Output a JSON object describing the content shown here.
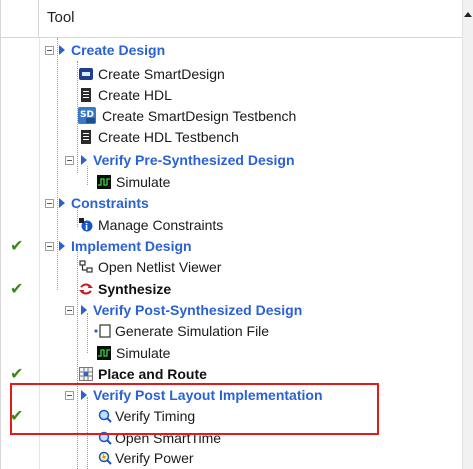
{
  "header": {
    "column_label": "Tool"
  },
  "colors": {
    "category": "#2a62d4",
    "check": "#3a8a1c",
    "highlight": "#e11a1a"
  },
  "rows": [
    {
      "label": "Create Design",
      "style": "category",
      "check": ""
    },
    {
      "label": "Create SmartDesign",
      "icon": "smartdesign-icon",
      "check": ""
    },
    {
      "label": "Create HDL",
      "icon": "hdl-file-icon",
      "check": ""
    },
    {
      "label": "Create SmartDesign Testbench",
      "icon": "sd-testbench-icon",
      "check": ""
    },
    {
      "label": "Create HDL Testbench",
      "icon": "hdl-testbench-icon",
      "check": ""
    },
    {
      "label": "Verify Pre-Synthesized Design",
      "style": "category",
      "check": ""
    },
    {
      "label": "Simulate",
      "icon": "simulate-icon",
      "check": ""
    },
    {
      "label": "Constraints",
      "style": "category",
      "check": ""
    },
    {
      "label": "Manage Constraints",
      "icon": "constraints-icon",
      "check": ""
    },
    {
      "label": "Implement Design",
      "style": "category",
      "check": "✔"
    },
    {
      "label": "Open Netlist Viewer",
      "icon": "netlist-icon",
      "check": ""
    },
    {
      "label": "Synthesize",
      "icon": "synthesize-icon",
      "style": "bold",
      "check": "✔"
    },
    {
      "label": "Verify Post-Synthesized Design",
      "style": "category",
      "check": ""
    },
    {
      "label": "Generate Simulation File",
      "icon": "gen-sim-file-icon",
      "check": ""
    },
    {
      "label": "Simulate",
      "icon": "simulate-icon",
      "check": ""
    },
    {
      "label": "Place and Route",
      "icon": "place-route-icon",
      "style": "bold",
      "check": "✔"
    },
    {
      "label": "Verify Post Layout Implementation",
      "style": "category",
      "check": ""
    },
    {
      "label": "Verify Timing",
      "icon": "verify-timing-icon",
      "check": "✔"
    },
    {
      "label": "Open SmartTime",
      "icon": "smarttime-icon",
      "check": ""
    },
    {
      "label": "Verify Power",
      "icon": "verify-power-icon",
      "check": ""
    }
  ]
}
